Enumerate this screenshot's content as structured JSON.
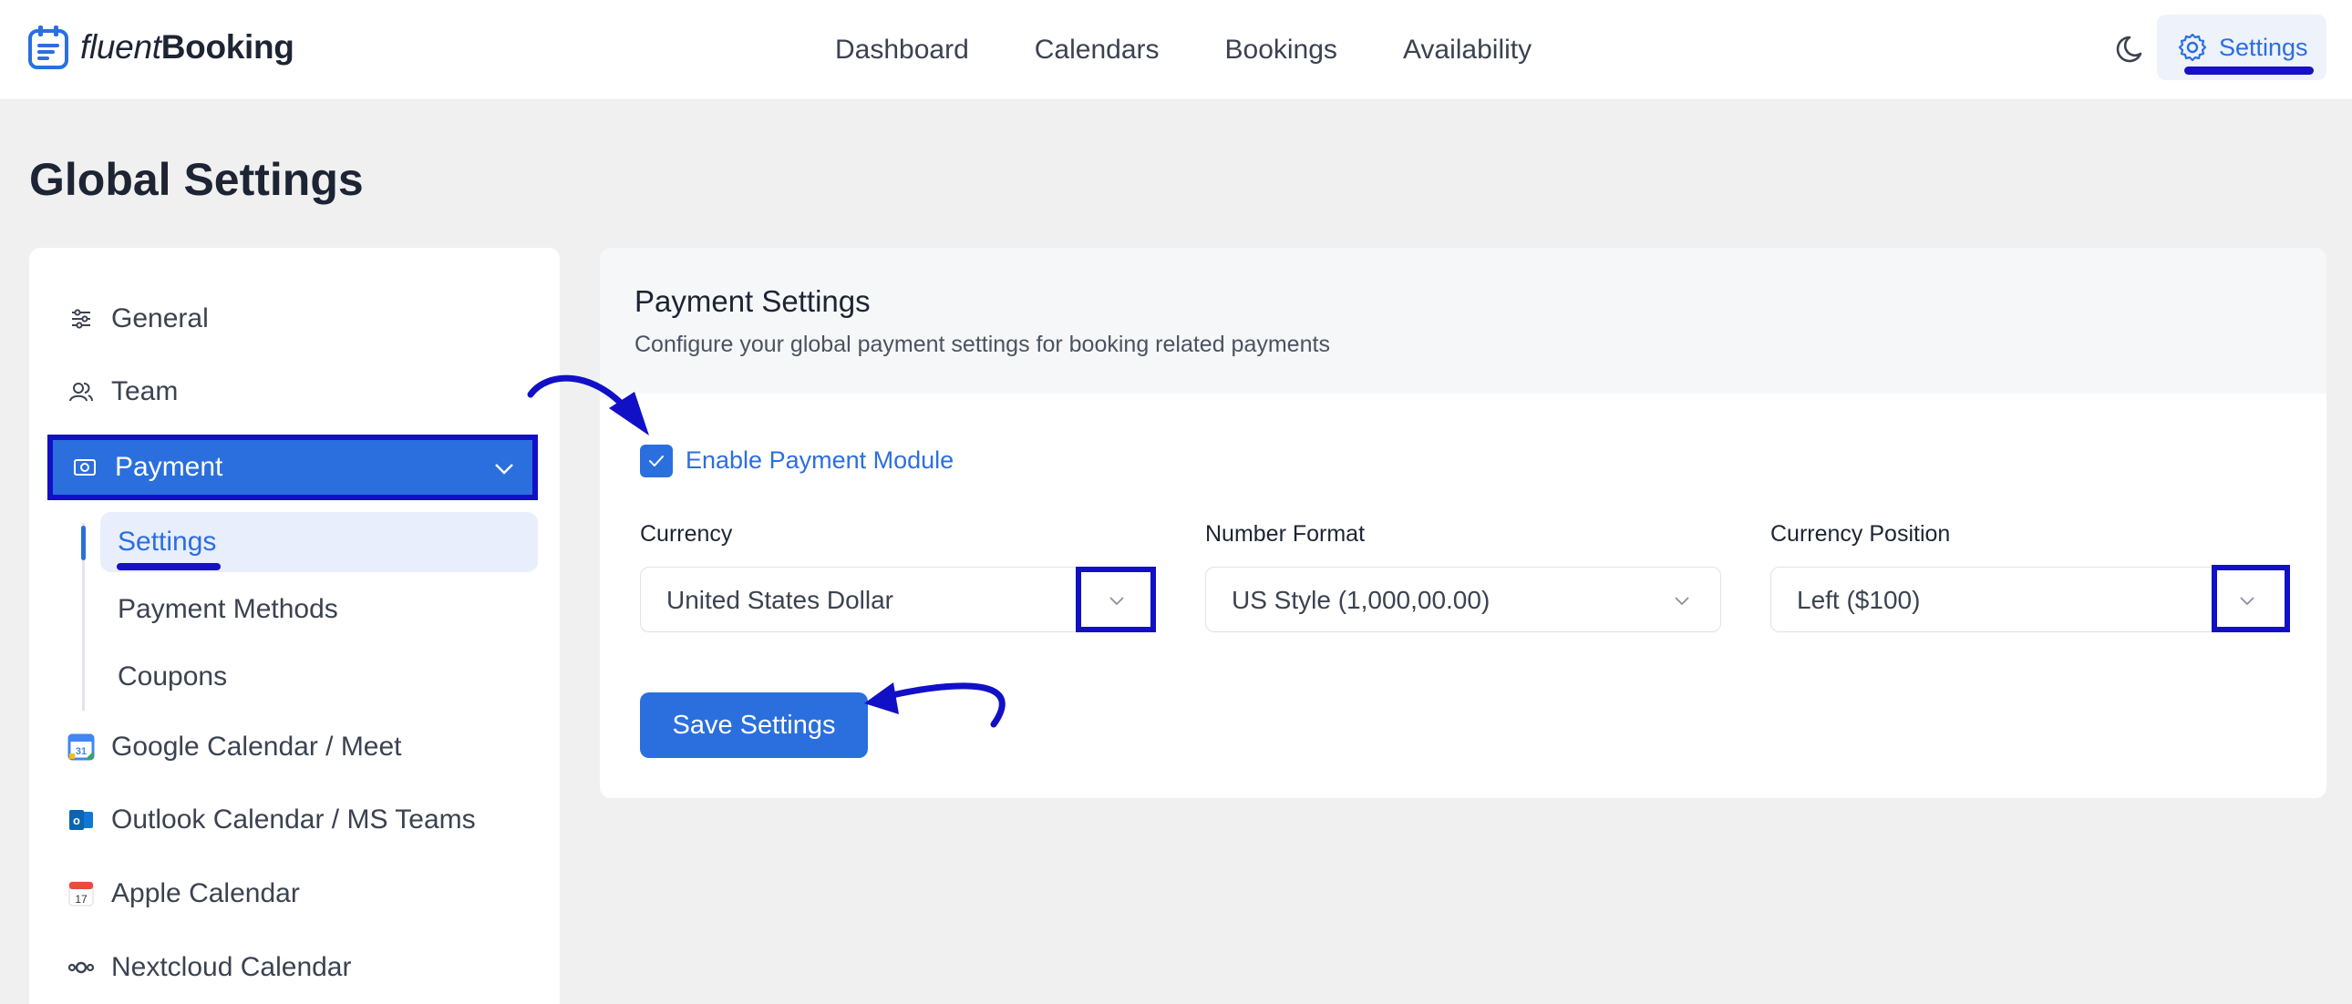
{
  "brand": {
    "name_part1": "fluent",
    "name_part2": "Booking"
  },
  "nav": {
    "items": [
      "Dashboard",
      "Calendars",
      "Bookings",
      "Availability"
    ]
  },
  "header": {
    "settings_label": "Settings"
  },
  "page": {
    "title": "Global Settings"
  },
  "sidebar": {
    "general": "General",
    "team": "Team",
    "payment": "Payment",
    "payment_sub": [
      "Settings",
      "Payment Methods",
      "Coupons"
    ],
    "google": "Google Calendar / Meet",
    "outlook": "Outlook Calendar / MS Teams",
    "apple": "Apple Calendar",
    "nextcloud": "Nextcloud Calendar"
  },
  "panel": {
    "title": "Payment Settings",
    "subtitle": "Configure your global payment settings for booking related payments",
    "enable_label": "Enable Payment Module",
    "enable_checked": true,
    "currency": {
      "label": "Currency",
      "value": "United States Dollar"
    },
    "number_format": {
      "label": "Number Format",
      "value": "US Style (1,000,00.00)"
    },
    "currency_position": {
      "label": "Currency Position",
      "value": "Left ($100)"
    },
    "save_label": "Save Settings"
  },
  "icons": {
    "calendar_badge": "31",
    "outlook_badge": "o",
    "apple_badge": "17"
  },
  "colors": {
    "accent": "#2a6fdd",
    "annotation": "#1210c6",
    "background": "#f0f0f1"
  }
}
